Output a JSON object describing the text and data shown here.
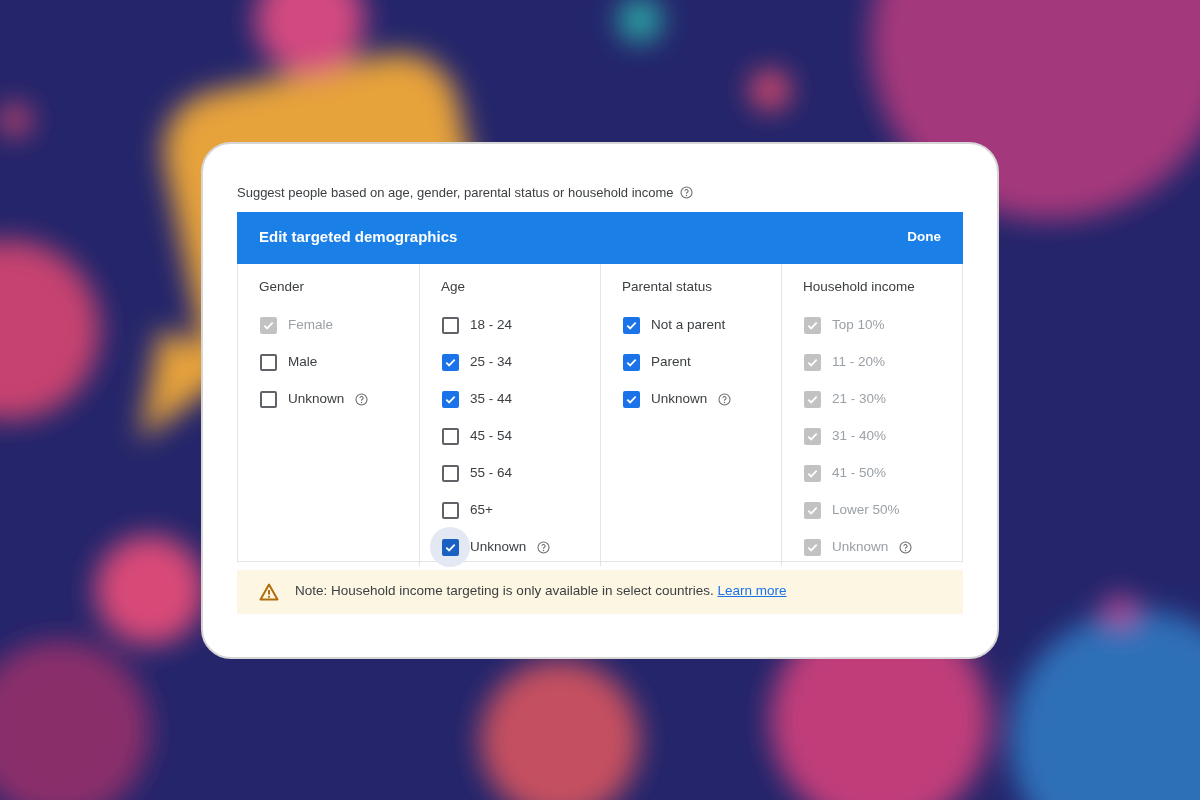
{
  "intro": {
    "text": "Suggest people based on age, gender, parental status or household income",
    "help": true
  },
  "header": {
    "title": "Edit targeted demographics",
    "action": "Done"
  },
  "columns": [
    {
      "heading": "Gender",
      "options": [
        {
          "label": "Female",
          "checked": true,
          "disabled": true,
          "focused": false,
          "help": false
        },
        {
          "label": "Male",
          "checked": false,
          "disabled": false,
          "focused": false,
          "help": false
        },
        {
          "label": "Unknown",
          "checked": false,
          "disabled": false,
          "focused": false,
          "help": true
        }
      ]
    },
    {
      "heading": "Age",
      "options": [
        {
          "label": "18 - 24",
          "checked": false,
          "disabled": false,
          "focused": false,
          "help": false
        },
        {
          "label": "25 - 34",
          "checked": true,
          "disabled": false,
          "focused": false,
          "help": false
        },
        {
          "label": "35 - 44",
          "checked": true,
          "disabled": false,
          "focused": false,
          "help": false
        },
        {
          "label": "45 - 54",
          "checked": false,
          "disabled": false,
          "focused": false,
          "help": false
        },
        {
          "label": "55 - 64",
          "checked": false,
          "disabled": false,
          "focused": false,
          "help": false
        },
        {
          "label": "65+",
          "checked": false,
          "disabled": false,
          "focused": false,
          "help": false
        },
        {
          "label": "Unknown",
          "checked": true,
          "disabled": false,
          "focused": true,
          "help": true
        }
      ]
    },
    {
      "heading": "Parental status",
      "options": [
        {
          "label": "Not a parent",
          "checked": true,
          "disabled": false,
          "focused": false,
          "help": false
        },
        {
          "label": "Parent",
          "checked": true,
          "disabled": false,
          "focused": false,
          "help": false
        },
        {
          "label": "Unknown",
          "checked": true,
          "disabled": false,
          "focused": false,
          "help": true
        }
      ]
    },
    {
      "heading": "Household income",
      "options": [
        {
          "label": "Top 10%",
          "checked": true,
          "disabled": true,
          "focused": false,
          "help": false
        },
        {
          "label": "11 - 20%",
          "checked": true,
          "disabled": true,
          "focused": false,
          "help": false
        },
        {
          "label": "21 - 30%",
          "checked": true,
          "disabled": true,
          "focused": false,
          "help": false
        },
        {
          "label": "31 - 40%",
          "checked": true,
          "disabled": true,
          "focused": false,
          "help": false
        },
        {
          "label": "41 - 50%",
          "checked": true,
          "disabled": true,
          "focused": false,
          "help": false
        },
        {
          "label": "Lower 50%",
          "checked": true,
          "disabled": true,
          "focused": false,
          "help": false
        },
        {
          "label": "Unknown",
          "checked": true,
          "disabled": true,
          "focused": false,
          "help": true
        }
      ]
    }
  ],
  "note": {
    "text": "Note: Household income targeting is only available in select countries.",
    "link": "Learn more"
  }
}
